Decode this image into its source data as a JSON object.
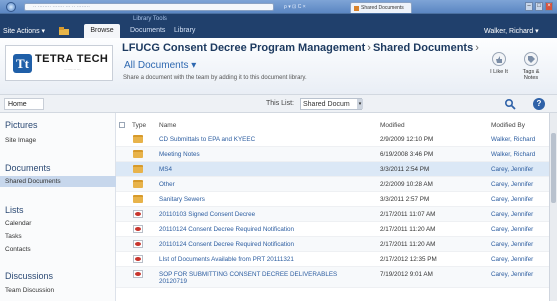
{
  "browser": {
    "tab_title": "Shared Documents"
  },
  "ribbon": {
    "context_label": "Library Tools",
    "site_actions": "Site Actions ▾",
    "tabs": [
      "Browse",
      "Documents",
      "Library"
    ],
    "user": "Walker, Richard ▾"
  },
  "header": {
    "logo_name": "TETRA TECH",
    "breadcrumb": [
      "LFUCG Consent Decree Program Management",
      "Shared Documents"
    ],
    "view_selector": "All Documents ▾",
    "description": "Share a document with the team by adding it to this document library.",
    "buttons": [
      {
        "label": "I Like It",
        "icon": "thumbs-up-icon"
      },
      {
        "label": "Tags & Notes",
        "icon": "tag-icon"
      }
    ]
  },
  "subbar": {
    "home": "Home",
    "this_list": "This List:",
    "search_scope": "Shared Docum"
  },
  "leftnav": {
    "sections": [
      {
        "heading": "Pictures",
        "items": [
          "Site Image"
        ]
      },
      {
        "heading": "Documents",
        "items": [
          "Shared Documents"
        ]
      },
      {
        "heading": "Lists",
        "items": [
          "Calendar",
          "Tasks",
          "Contacts"
        ]
      },
      {
        "heading": "Discussions",
        "items": [
          "Team Discussion"
        ]
      }
    ]
  },
  "list": {
    "columns": [
      "Type",
      "Name",
      "Modified",
      "Modified By"
    ],
    "rows": [
      {
        "type": "folder",
        "name": "CD Submittals to EPA and KYEEC",
        "modified": "2/9/2009 12:10 PM",
        "by": "Walker, Richard"
      },
      {
        "type": "folder",
        "name": "Meeting Notes",
        "modified": "6/19/2008 3:46 PM",
        "by": "Walker, Richard"
      },
      {
        "type": "folder",
        "name": "MS4",
        "modified": "3/3/2011 2:54 PM",
        "by": "Carey, Jennifer"
      },
      {
        "type": "folder",
        "name": "Other",
        "modified": "2/2/2009 10:28 AM",
        "by": "Carey, Jennifer"
      },
      {
        "type": "folder",
        "name": "Sanitary Sewers",
        "modified": "3/3/2011 2:57 PM",
        "by": "Carey, Jennifer"
      },
      {
        "type": "pdf",
        "name": "20110103 Signed Consent Decree",
        "modified": "2/17/2011 11:07 AM",
        "by": "Carey, Jennifer"
      },
      {
        "type": "pdf",
        "name": "20110124 Consent Decree Required Notification",
        "modified": "2/17/2011 11:20 AM",
        "by": "Carey, Jennifer"
      },
      {
        "type": "pdf",
        "name": "20110124 Consent Decree Required Notification",
        "modified": "2/17/2011 11:20 AM",
        "by": "Carey, Jennifer"
      },
      {
        "type": "pdf",
        "name": "LIst of Documents Available from PRT 20111321",
        "modified": "2/17/2012 12:35 PM",
        "by": "Carey, Jennifer"
      },
      {
        "type": "pdf",
        "name": "SOP FOR SUBMITTING CONSENT DECREE DELIVERABLES",
        "name2": "20120719",
        "modified": "7/19/2012 9:01 AM",
        "by": "Carey, Jennifer"
      }
    ]
  }
}
